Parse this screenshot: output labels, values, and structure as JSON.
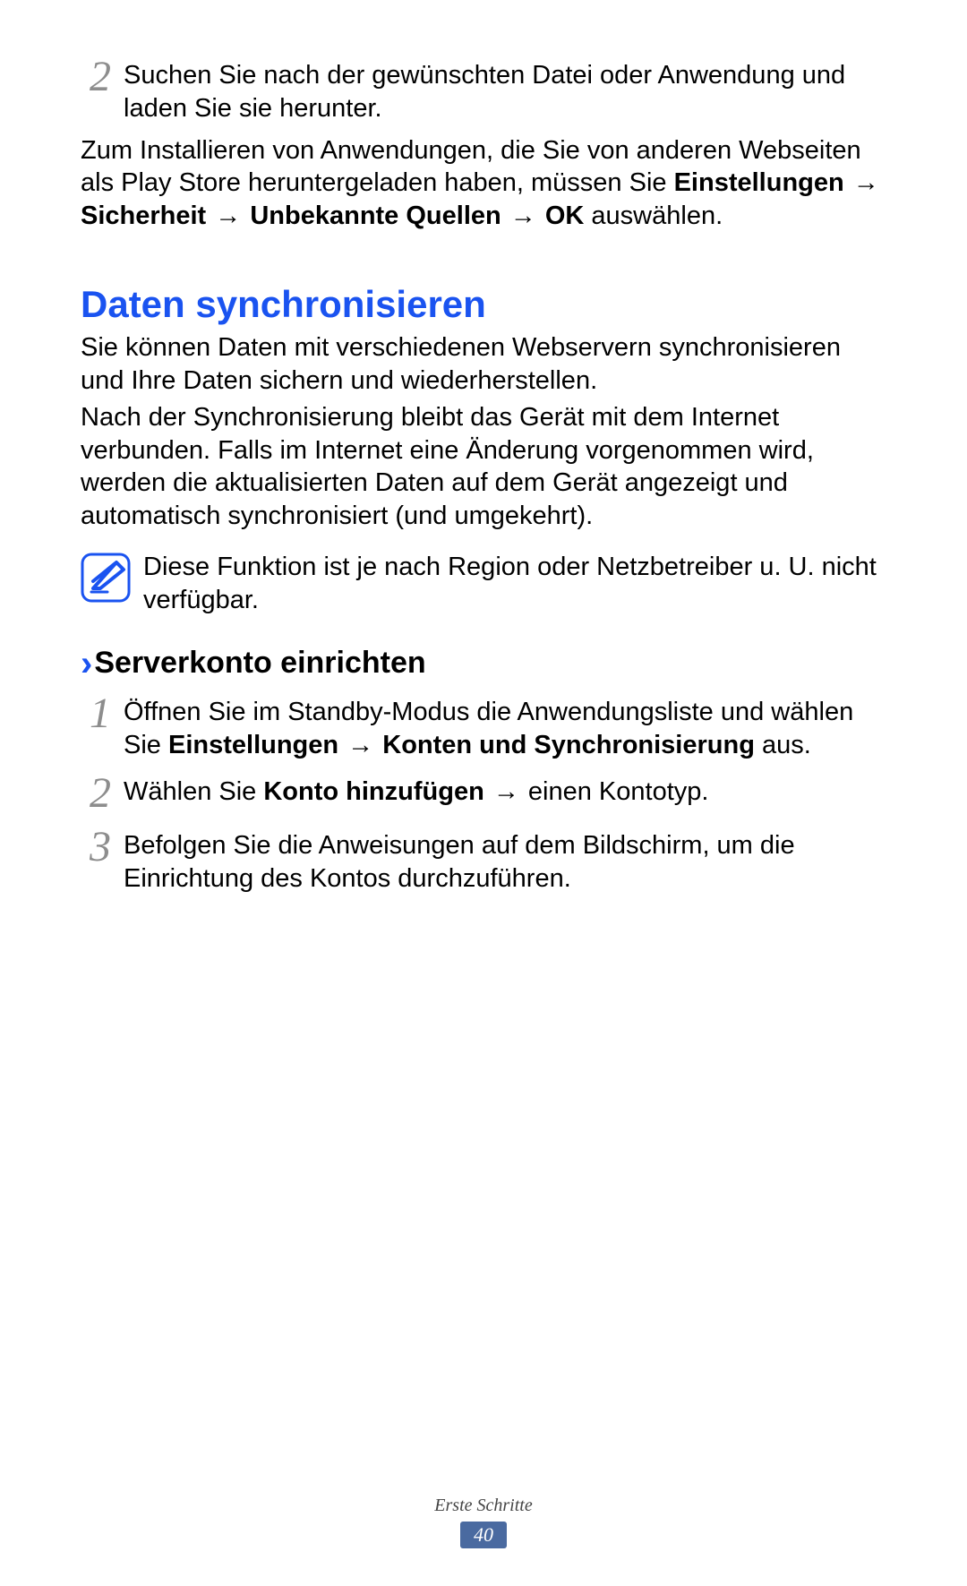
{
  "top_step": {
    "num": "2",
    "text": "Suchen Sie nach der gewünschten Datei oder Anwendung und laden Sie sie herunter."
  },
  "install_para": {
    "pre": "Zum Installieren von Anwendungen, die Sie von anderen Webseiten als Play Store heruntergeladen haben, müssen Sie ",
    "b1": "Einstellungen",
    "a1": " → ",
    "b2": "Sicherheit",
    "a2": " → ",
    "b3": "Unbekannte Quellen",
    "a3": " → ",
    "b4": "OK",
    "post": " auswählen."
  },
  "h1": "Daten synchronisieren",
  "sync_para1": "Sie können Daten mit verschiedenen Webservern synchronisieren und Ihre Daten sichern und wiederherstellen.",
  "sync_para2": "Nach der Synchronisierung bleibt das Gerät mit dem Internet verbunden. Falls im Internet eine Änderung vorgenommen wird, werden die aktualisierten Daten auf dem Gerät angezeigt und automatisch synchronisiert (und umgekehrt).",
  "note": "Diese Funktion ist je nach Region oder Netzbetreiber u. U. nicht verfügbar.",
  "h2_chevron": "›",
  "h2": "Serverkonto einrichten",
  "steps": {
    "s1": {
      "num": "1",
      "pre": "Öffnen Sie im Standby-Modus die Anwendungsliste und wählen Sie ",
      "b1": "Einstellungen",
      "a1": " → ",
      "b2": "Konten und Synchronisierung",
      "post": " aus."
    },
    "s2": {
      "num": "2",
      "pre": "Wählen Sie ",
      "b1": "Konto hinzufügen",
      "a1": " → ",
      "post": "einen Kontotyp."
    },
    "s3": {
      "num": "3",
      "text": "Befolgen Sie die Anweisungen auf dem Bildschirm, um die Einrichtung des Kontos durchzuführen."
    }
  },
  "footer_label": "Erste Schritte",
  "page_number": "40"
}
